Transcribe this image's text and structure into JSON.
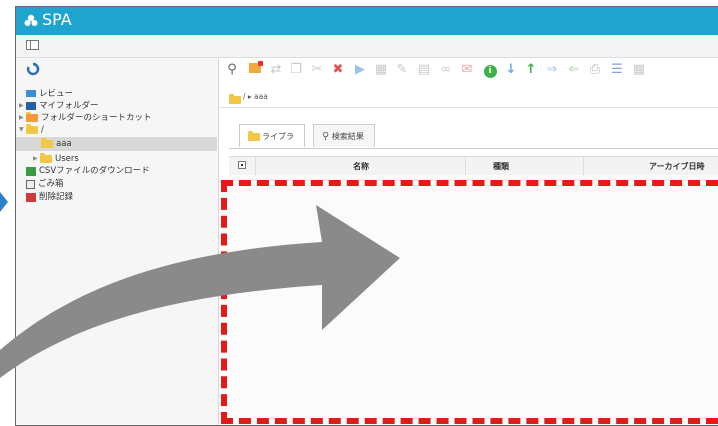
{
  "app": {
    "title": "SPA"
  },
  "sidebar": {
    "items": [
      {
        "label": "レビュー",
        "icon": "review-icon"
      },
      {
        "label": "マイフォルダー",
        "icon": "my-folder-icon"
      },
      {
        "label": "フォルダーのショートカット",
        "icon": "folder-shortcut-icon"
      },
      {
        "label": "/",
        "icon": "folder-icon"
      },
      {
        "label": "aaa",
        "icon": "folder-icon"
      },
      {
        "label": "Users",
        "icon": "folder-icon"
      },
      {
        "label": "CSVファイルのダウンロード",
        "icon": "csv-download-icon"
      },
      {
        "label": "ごみ箱",
        "icon": "trash-icon"
      },
      {
        "label": "削除記録",
        "icon": "deletion-record-icon"
      }
    ]
  },
  "breadcrumb": {
    "path": "/ ▸ aaa"
  },
  "tabs": [
    {
      "label": "ライブラリ",
      "icon": "folder-icon"
    },
    {
      "label": "検索結果",
      "icon": "search-icon"
    }
  ],
  "table": {
    "columns": [
      "名称",
      "種類",
      "アーカイブ日時"
    ]
  },
  "colors": {
    "titlebar": "#1fa3cf",
    "highlight": "#e61919",
    "arrow": "#8a8a8a",
    "pointer": "#2f7fc9"
  }
}
